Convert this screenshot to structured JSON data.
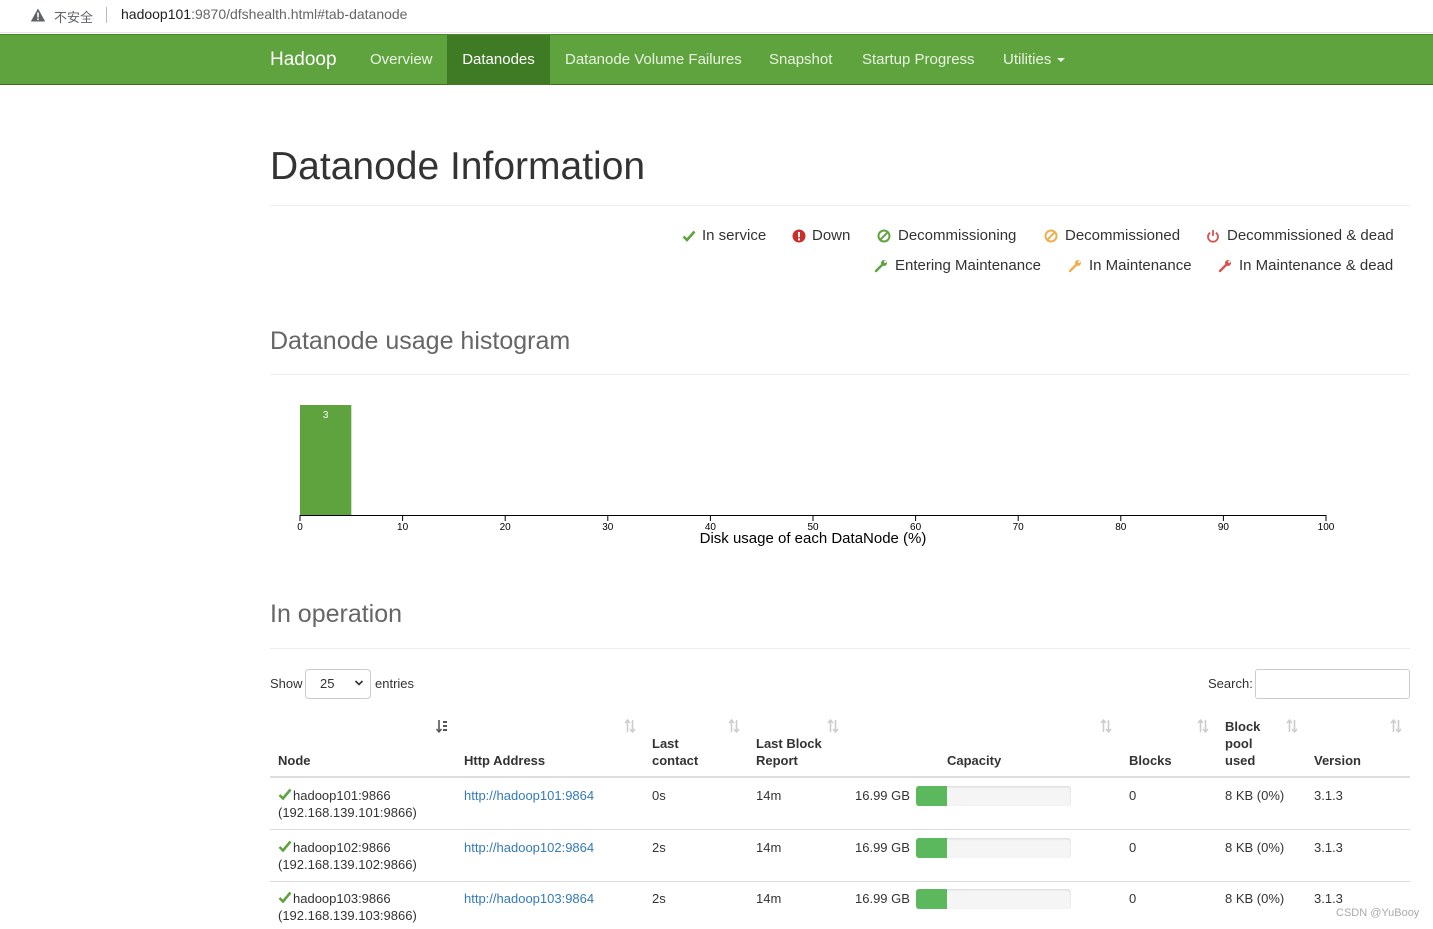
{
  "browser": {
    "insecure_label": "不安全",
    "url_host": "hadoop101",
    "url_rest": ":9870/dfshealth.html#tab-datanode"
  },
  "navbar": {
    "brand": "Hadoop",
    "items": [
      {
        "label": "Overview"
      },
      {
        "label": "Datanodes"
      },
      {
        "label": "Datanode Volume Failures"
      },
      {
        "label": "Snapshot"
      },
      {
        "label": "Startup Progress"
      },
      {
        "label": "Utilities"
      }
    ],
    "active": "Datanodes",
    "color": "#5fa33e"
  },
  "page": {
    "title": "Datanode Information"
  },
  "legend": [
    {
      "label": "In service",
      "icon": "check-icon",
      "color": "#5fa33e"
    },
    {
      "label": "Down",
      "icon": "exclamation-circle-icon",
      "color": "#d9534f"
    },
    {
      "label": "Decommissioning",
      "icon": "ban-icon",
      "color": "#5fa33e"
    },
    {
      "label": "Decommissioned",
      "icon": "ban-icon",
      "color": "#f0ad4e"
    },
    {
      "label": "Decommissioned & dead",
      "icon": "power-icon",
      "color": "#d9534f"
    },
    {
      "label": "Entering Maintenance",
      "icon": "wrench-icon",
      "color": "#5fa33e"
    },
    {
      "label": "In Maintenance",
      "icon": "wrench-icon",
      "color": "#f0ad4e"
    },
    {
      "label": "In Maintenance & dead",
      "icon": "wrench-icon",
      "color": "#d9534f"
    }
  ],
  "histogram": {
    "title": "Datanode usage histogram"
  },
  "chart_data": {
    "type": "bar",
    "xlabel": "Disk usage of each DataNode (%)",
    "xlim": [
      0,
      100
    ],
    "ticks": [
      0,
      10,
      20,
      30,
      40,
      50,
      60,
      70,
      80,
      90,
      100
    ],
    "bins": [
      {
        "x0": 0,
        "x1": 5,
        "value": 3,
        "label": "3"
      }
    ],
    "bar_color": "#5fa33e"
  },
  "operation": {
    "title": "In operation",
    "show_label": "Show",
    "page_length": "25",
    "entries_label": "entries",
    "search_label": "Search:",
    "columns": [
      {
        "label": "Node"
      },
      {
        "label": "Http Address"
      },
      {
        "label": "Last\ncontact"
      },
      {
        "label": "Last Block\nReport"
      },
      {
        "label": "Capacity"
      },
      {
        "label": "Blocks"
      },
      {
        "label": "Block\npool\nused"
      },
      {
        "label": "Version"
      }
    ],
    "rows": [
      {
        "node": "hadoop101:9866",
        "node_ip": "(192.168.139.101:9866)",
        "http": "http://hadoop101:9864",
        "last_contact": "0s",
        "last_block_report": "14m",
        "capacity": "16.99 GB",
        "capacity_used_fraction": 0.2,
        "blocks": "0",
        "block_pool_used": "8 KB (0%)",
        "version": "3.1.3"
      },
      {
        "node": "hadoop102:9866",
        "node_ip": "(192.168.139.102:9866)",
        "http": "http://hadoop102:9864",
        "last_contact": "2s",
        "last_block_report": "14m",
        "capacity": "16.99 GB",
        "capacity_used_fraction": 0.2,
        "blocks": "0",
        "block_pool_used": "8 KB (0%)",
        "version": "3.1.3"
      },
      {
        "node": "hadoop103:9866",
        "node_ip": "(192.168.139.103:9866)",
        "http": "http://hadoop103:9864",
        "last_contact": "2s",
        "last_block_report": "14m",
        "capacity": "16.99 GB",
        "capacity_used_fraction": 0.2,
        "blocks": "0",
        "block_pool_used": "8 KB (0%)",
        "version": "3.1.3"
      }
    ]
  },
  "watermark": "CSDN @YuBooy"
}
